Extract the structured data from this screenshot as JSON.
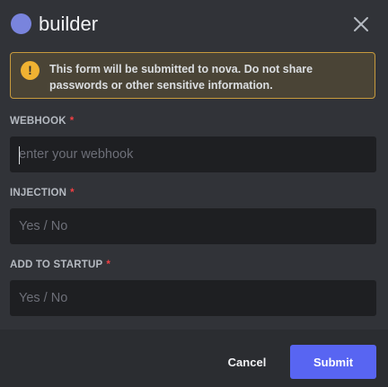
{
  "header": {
    "title": "builder",
    "avatar_color": "#7984dd",
    "close_icon": "close-icon"
  },
  "warning": {
    "icon": "warning-icon",
    "icon_glyph": "!",
    "text_prefix": "This form will be submitted to ",
    "target": "nova",
    "text_suffix": ". Do not share passwords or other sensitive information."
  },
  "fields": [
    {
      "label": "WEBHOOK",
      "required_mark": "*",
      "placeholder": "enter your webhook",
      "value": ""
    },
    {
      "label": "INJECTION",
      "required_mark": "*",
      "placeholder": "Yes / No",
      "value": ""
    },
    {
      "label": "ADD TO STARTUP",
      "required_mark": "*",
      "placeholder": "Yes / No",
      "value": ""
    }
  ],
  "footer": {
    "cancel_label": "Cancel",
    "submit_label": "Submit"
  },
  "colors": {
    "background": "#313338",
    "footer": "#2b2d31",
    "input": "#1e1f22",
    "accent": "#5865f2",
    "warning_border": "#c79a3d",
    "warning_icon": "#f0b232",
    "required": "#f23f43"
  }
}
